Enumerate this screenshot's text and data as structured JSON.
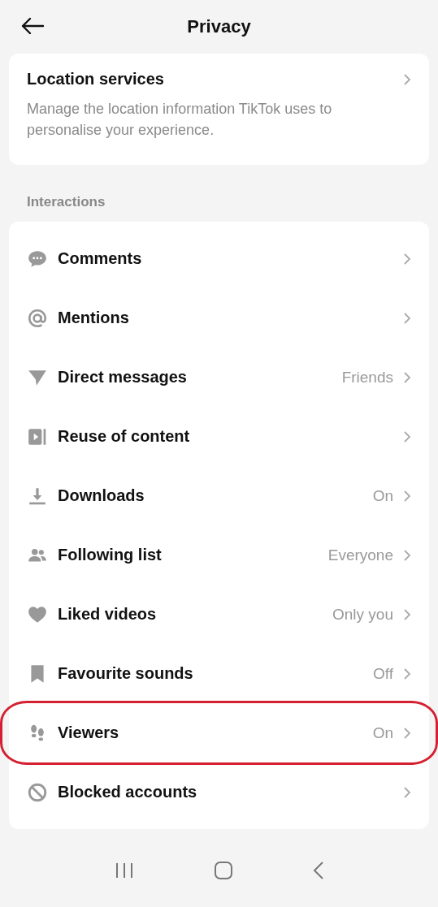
{
  "header": {
    "title": "Privacy"
  },
  "location": {
    "title": "Location services",
    "description": "Manage the location information TikTok uses to personalise your experience."
  },
  "section": {
    "title": "Interactions"
  },
  "items": [
    {
      "label": "Comments",
      "highlighted": false
    },
    {
      "label": "Mentions",
      "highlighted": false
    },
    {
      "label": "Direct messages",
      "value": "Friends",
      "highlighted": false
    },
    {
      "label": "Reuse of content",
      "highlighted": false
    },
    {
      "label": "Downloads",
      "value": "On",
      "highlighted": false
    },
    {
      "label": "Following list",
      "value": "Everyone",
      "highlighted": false
    },
    {
      "label": "Liked videos",
      "value": "Only you",
      "highlighted": false
    },
    {
      "label": "Favourite sounds",
      "value": "Off",
      "highlighted": false
    },
    {
      "label": "Viewers",
      "value": "On",
      "highlighted": true
    },
    {
      "label": "Blocked accounts",
      "highlighted": false
    }
  ]
}
